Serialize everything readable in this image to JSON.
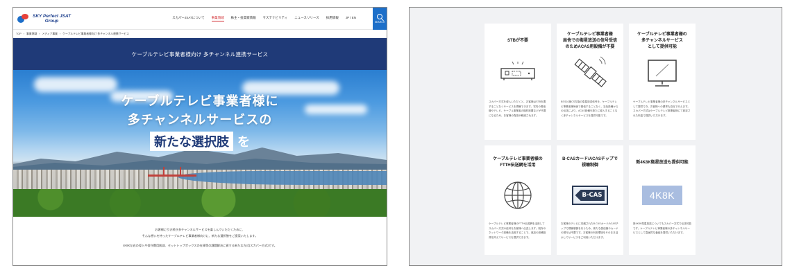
{
  "left": {
    "logo": {
      "line1": "SKY Perfect JSAT",
      "line2": "Group"
    },
    "nav": [
      {
        "label": "スカパーJSATについて",
        "active": false
      },
      {
        "label": "事業領域",
        "active": true
      },
      {
        "label": "株主・投資家情報",
        "active": false
      },
      {
        "label": "サステナビリティ",
        "active": false
      },
      {
        "label": "ニュースリリース",
        "active": false
      },
      {
        "label": "採用情報",
        "active": false
      },
      {
        "label": "JP / EN",
        "active": false
      }
    ],
    "search_label": "SEARCH",
    "breadcrumb": [
      "TOP",
      "事業領域",
      "メディア事業",
      "ケーブルテレビ事業者様向け 多チャンネル連携サービス"
    ],
    "banner_title": "ケーブルテレビ事業者様向け 多チャンネル連携サービス",
    "hero": {
      "line1": "ケーブルテレビ事業者様に",
      "line2": "多チャンネルサービスの",
      "highlight": "新たな選択肢",
      "suffix": "を"
    },
    "body": [
      "お客様に引き続き多チャンネルサービスを楽しんでいただくために、",
      "そんな想いを持ったケーブルテレビ事業者様向けに、新たな選択肢をご提案いたします。",
      "4K8K左右の導入や保守費用削減、セットトップボックスの在庫等の課題解決に資する新たな方式(スカパー方式)です。"
    ]
  },
  "cards": [
    {
      "title": "STBが不要",
      "icon": "set-top-box-icon",
      "desc": "スカパー方式を導入いただくと、お客様はSTBを要することなくサービスを視聴できます。宅内の受信機やテレビ、ケーブル事業者の機材設置などが不要になるため、お客様の負担が軽減されます。"
    },
    {
      "title": "ケーブルテレビ事業者様\n局舎での衛星放送の信号受信\nのためACAS用設備が不要",
      "icon": "satellite-icon",
      "desc": "BS/110度CS左旋の衛星放送信号を、ケーブルテレビ事業者様局舎で受信することなく、当社設備からの伝送により、ACAS設備を新たに導入することなく多チャンネルサービスを提供可能です。"
    },
    {
      "title": "ケーブルテレビ事業者様の\n多チャンネルサービス\nとして提供可能",
      "icon": "television-icon",
      "desc": "ケーブルテレビ事業者様の多チャンネルサービスとして提供でき、お客様への請求も自社で行えます。スカパー方式はケーブルテレビ事業者様にて設定された料金で提供いただけます。"
    },
    {
      "title": "ケーブルテレビ事業者様の\nFTTH伝送網を活用",
      "icon": "globe-network-icon",
      "desc": "ケーブルテレビ事業者様のFTTH伝送網を活用してスカパー方式の信号をお客様へ伝送します。既存のネットワーク設備を活用することで、追加の設備投資を抑えてサービスを提供できます。"
    },
    {
      "title": "B-CASカード/ACASチップで\n視聴制御",
      "icon": "b-cas-card-icon",
      "badge": "B-CAS",
      "desc": "お客様のテレビに内蔵されたB-CASカード/ACASチップで視聴制御を行うため、新たな受信機やカードの発行は不要です。お客様の利用環境をそのまま活かしてサービスをご利用いただけます。"
    },
    {
      "title": "新4K8K衛星放送も提供可能",
      "icon": "4k8k-icon",
      "badge": "4K8K",
      "desc": "新4K8K衛星放送についてもスカパー方式で伝送可能です。ケーブルテレビ事業者様の多チャンネルサービスとして高画質な番組を提供いただけます。"
    }
  ]
}
